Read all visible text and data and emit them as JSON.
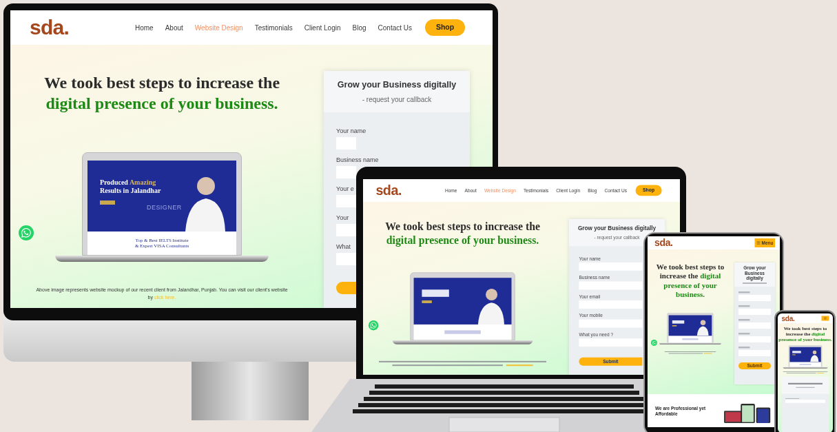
{
  "devices": [
    {
      "kind": "desktop",
      "site": {
        "logo": "sda.",
        "nav": [
          {
            "label": "Home",
            "selected": false
          },
          {
            "label": "About",
            "selected": false
          },
          {
            "label": "Website Design",
            "selected": true
          },
          {
            "label": "Testimonials",
            "selected": false
          },
          {
            "label": "Client Login",
            "selected": false
          },
          {
            "label": "Blog",
            "selected": false
          },
          {
            "label": "Contact Us",
            "selected": false
          }
        ],
        "shop": "Shop",
        "headline": {
          "text": "We took best steps to increase the",
          "highlight": "digital presence of your business."
        },
        "mockup": {
          "title": "Produced",
          "title_highlight": "Amazing",
          "title_rest": "Results in Jalandhar",
          "watermark": "DESIGNER",
          "subtitle": "Top & Best IELTS Institute",
          "subtitle_2": "& Expert VISA Consultants"
        },
        "caption": "Above image represents website mockup of our recent client from Jalandhar, Punjab. You can visit our client's website by",
        "link": "click here.",
        "form": {
          "title": "Grow your Business digitally",
          "subtitle": "- request your callback",
          "fields": [
            "Your name",
            "Business name",
            "Your e",
            "Your",
            "What"
          ]
        }
      }
    },
    {
      "kind": "laptop",
      "site": {
        "logo": "sda.",
        "nav": [
          {
            "label": "Home",
            "selected": false
          },
          {
            "label": "About",
            "selected": false
          },
          {
            "label": "Website Design",
            "selected": true
          },
          {
            "label": "Testimonials",
            "selected": false
          },
          {
            "label": "Client Login",
            "selected": false
          },
          {
            "label": "Blog",
            "selected": false
          },
          {
            "label": "Contact Us",
            "selected": false
          }
        ],
        "shop": "Shop",
        "headline": {
          "text": "We took best steps to increase the",
          "highlight": "digital presence of your business."
        },
        "form": {
          "title": "Grow your Business digitally",
          "subtitle": "- request your callback",
          "fields": [
            "Your name",
            "Business name",
            "Your email",
            "Your mobile",
            "What you need ?"
          ],
          "submit": "Submit"
        }
      }
    },
    {
      "kind": "tablet",
      "site": {
        "logo": "sda.",
        "menu": "Menu",
        "headline": {
          "text": "We took best steps to increase the",
          "highlight": "digital presence of your business."
        },
        "form": {
          "title": "Grow your Business digitally",
          "submit": "Submit"
        },
        "section_title": "We are Professional yet Affordable"
      }
    },
    {
      "kind": "phone",
      "site": {
        "logo": "sda.",
        "headline": {
          "text": "We took best steps to increase the",
          "highlight": "digital presence of your business."
        }
      }
    }
  ]
}
